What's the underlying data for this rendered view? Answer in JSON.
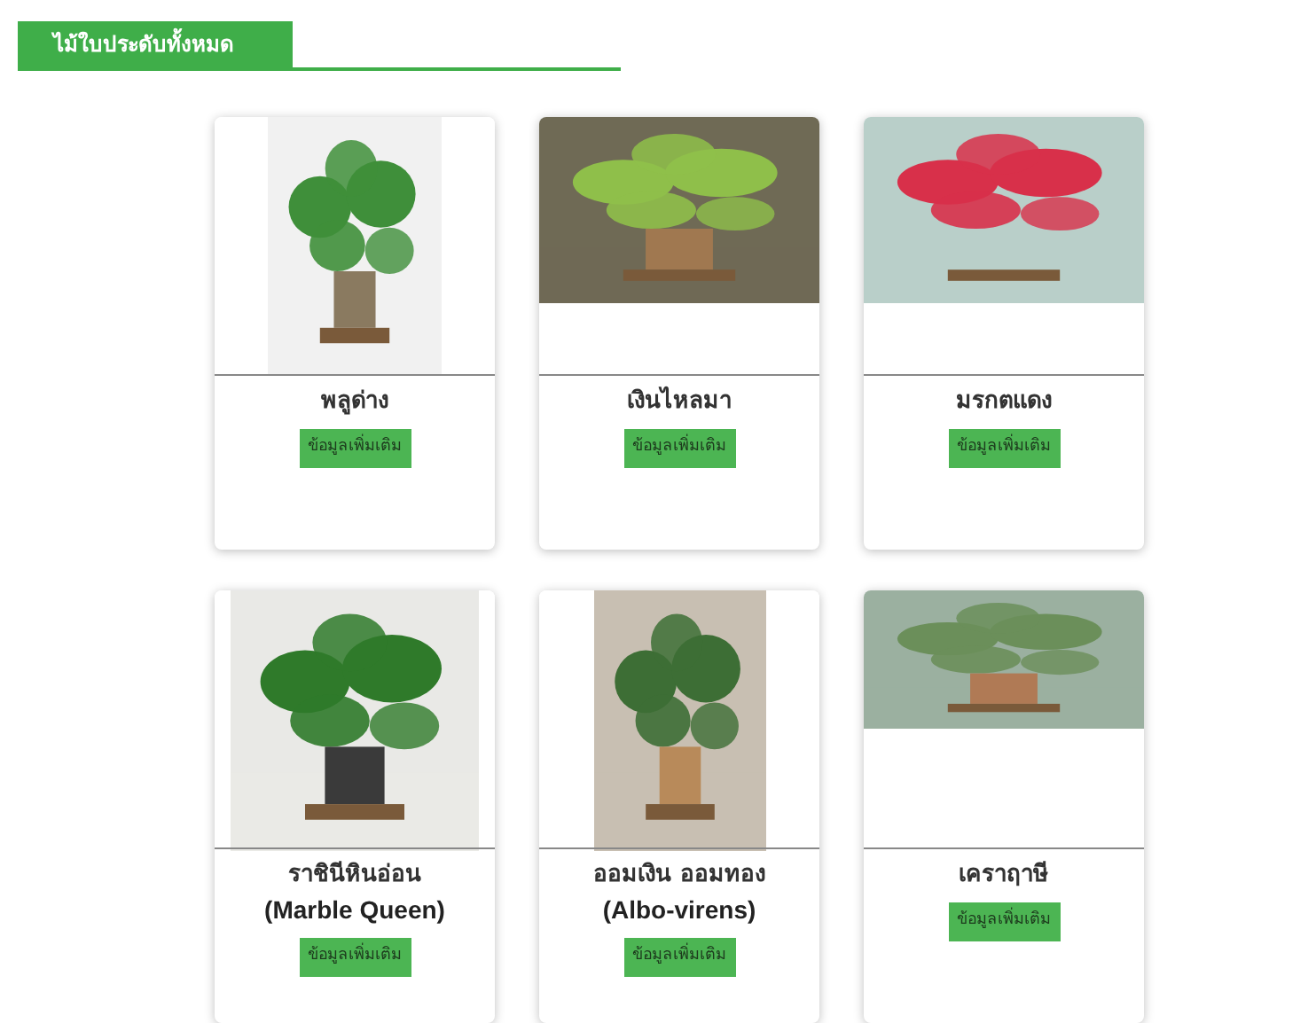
{
  "header": {
    "title": "ไม้ใบประดับทั้งหมด"
  },
  "cards": [
    {
      "name_lines": [
        "พลูด่าง"
      ],
      "button": "ข้อมูลเพิ่มเติม"
    },
    {
      "name_lines": [
        "เงินไหลมา"
      ],
      "button": "ข้อมูลเพิ่มเติม"
    },
    {
      "name_lines": [
        "มรกตแดง"
      ],
      "button": "ข้อมูลเพิ่มเติม"
    },
    {
      "name_lines": [
        "ราชินีหินอ่อน",
        "(Marble Queen)"
      ],
      "button": "ข้อมูลเพิ่มเติม"
    },
    {
      "name_lines": [
        "ออมเงิน ออมทอง",
        "(Albo-virens)"
      ],
      "button": "ข้อมูลเพิ่มเติม"
    },
    {
      "name_lines": [
        "เคราฤาษี"
      ],
      "button": "ข้อมูลเพิ่มเติม"
    }
  ]
}
